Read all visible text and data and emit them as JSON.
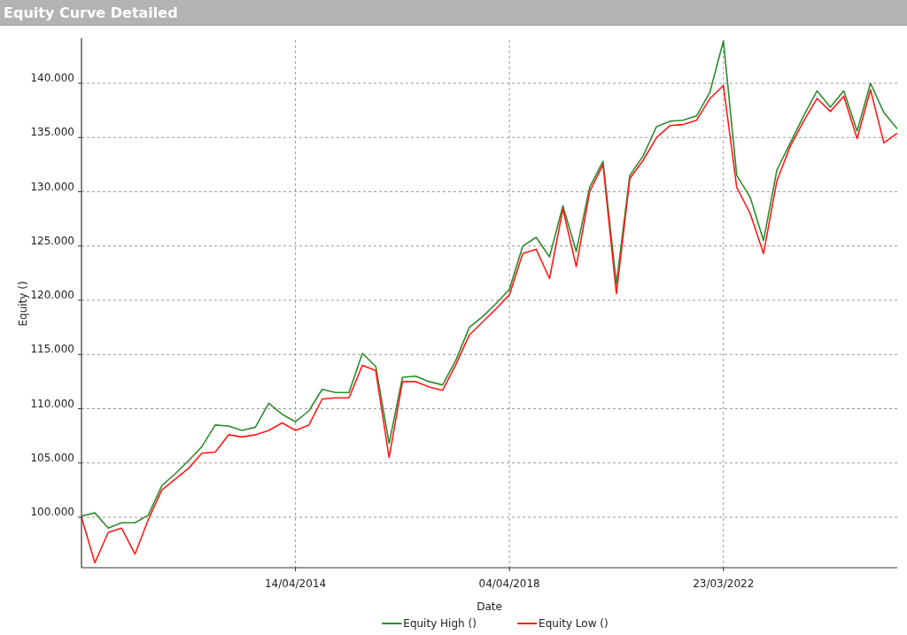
{
  "window": {
    "title": "Equity Curve Detailed"
  },
  "chart": {
    "chart_data": {
      "type": "line",
      "xlabel": "Date",
      "ylabel": "Equity ()",
      "ylim": [
        95350,
        144000
      ],
      "grid": true,
      "legend": true,
      "yticks": [
        {
          "value": 100000,
          "label": "100.000"
        },
        {
          "value": 105000,
          "label": "105.000"
        },
        {
          "value": 110000,
          "label": "110.000"
        },
        {
          "value": 115000,
          "label": "115.000"
        },
        {
          "value": 120000,
          "label": "120.000"
        },
        {
          "value": 125000,
          "label": "125.000"
        },
        {
          "value": 130000,
          "label": "130.000"
        },
        {
          "value": 135000,
          "label": "135.000"
        },
        {
          "value": 140000,
          "label": "140.000"
        }
      ],
      "categories": [
        null,
        null,
        null,
        null,
        null,
        null,
        null,
        null,
        null,
        null,
        null,
        null,
        null,
        null,
        null,
        null,
        "14/04/2014",
        null,
        null,
        null,
        null,
        null,
        null,
        null,
        null,
        null,
        null,
        null,
        null,
        null,
        null,
        null,
        "04/04/2018",
        null,
        null,
        null,
        null,
        null,
        null,
        null,
        null,
        null,
        null,
        null,
        null,
        null,
        null,
        null,
        "23/03/2022",
        null,
        null,
        null,
        null,
        null,
        null,
        null,
        null,
        null,
        null,
        null,
        null,
        null
      ],
      "series": [
        {
          "name": "Equity High ()",
          "color": "#2e8b2e",
          "values": [
            100100,
            100400,
            99000,
            99500,
            99500,
            100200,
            102900,
            104000,
            105200,
            106500,
            108500,
            108400,
            108000,
            108300,
            110500,
            109500,
            108800,
            109800,
            111800,
            111500,
            111500,
            115100,
            113900,
            106800,
            112900,
            113000,
            112500,
            112200,
            114500,
            117500,
            118500,
            119700,
            121000,
            125000,
            125800,
            124000,
            128700,
            124500,
            130400,
            132800,
            121500,
            131500,
            133300,
            136000,
            136500,
            136600,
            137000,
            139200,
            143900,
            131500,
            129500,
            125500,
            132000,
            134500,
            137000,
            139300,
            137800,
            139300,
            135600,
            140000,
            137300,
            135800
          ]
        },
        {
          "name": "Equity Low ()",
          "color": "#ff1a1a",
          "values": [
            100000,
            95800,
            98600,
            99000,
            96600,
            99800,
            102500,
            103500,
            104500,
            105900,
            106000,
            107600,
            107400,
            107600,
            108000,
            108700,
            108000,
            108500,
            110900,
            111000,
            111000,
            114000,
            113500,
            105500,
            112500,
            112500,
            112000,
            111700,
            114100,
            116800,
            118000,
            119200,
            120500,
            124300,
            124700,
            122000,
            128400,
            123100,
            130000,
            132500,
            120600,
            131200,
            132900,
            135000,
            136100,
            136200,
            136600,
            138600,
            139800,
            130400,
            128000,
            124300,
            131000,
            134200,
            136500,
            138600,
            137400,
            138800,
            134900,
            139400,
            134500,
            135400
          ]
        }
      ]
    }
  }
}
